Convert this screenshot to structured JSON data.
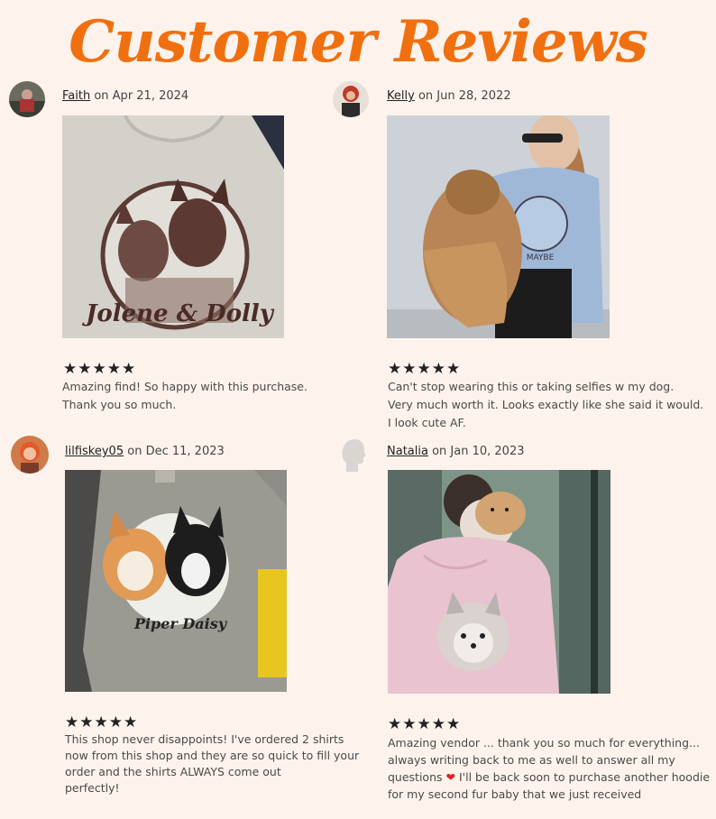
{
  "page": {
    "title": "Customer Reviews"
  },
  "reviews": [
    {
      "user": "Faith",
      "date": "on Apr 21, 2024",
      "stars": "★★★★★",
      "rating": 5,
      "lines": [
        "Amazing find! So happy with this purchase.",
        "Thank you so much."
      ],
      "shirt_text": "Jolene & Dolly"
    },
    {
      "user": "Kelly",
      "date": "on Jun 28, 2022",
      "stars": "★★★★★",
      "rating": 5,
      "lines": [
        "Can't stop wearing this or taking selfies w my dog.",
        "Very much worth it. Looks exactly like she said it would.",
        "I look cute AF."
      ],
      "shirt_text": "MAYBE"
    },
    {
      "user": "lilfiskey05",
      "date": "on Dec 11, 2023",
      "stars": "★★★★★",
      "rating": 5,
      "lines": [
        "This shop never disappoints! I've ordered 2 shirts",
        "now from this shop and they are so quick to fill your",
        "order and the shirts ALWAYS come out",
        "perfectly!"
      ],
      "shirt_text": "Piper Daisy"
    },
    {
      "user": "Natalia",
      "date": "on Jan 10, 2023",
      "stars": "★★★★★",
      "rating": 5,
      "lines": [
        "Amazing vendor ... thank you so much for everything...",
        "always writing back to me as well to answer all my",
        "I'll be back soon to purchase another hoodie",
        "for my second fur baby that we just received"
      ],
      "line3_prefix": "questions",
      "heart": "❤"
    }
  ]
}
